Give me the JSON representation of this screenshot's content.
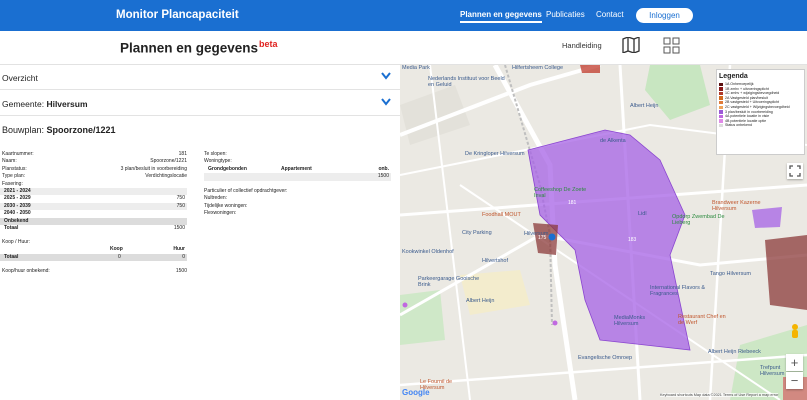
{
  "header": {
    "brand": "Monitor Plancapaciteit",
    "nav": [
      "Plannen en gegevens",
      "Publicaties",
      "Contact"
    ],
    "login": "Inloggen"
  },
  "subheader": {
    "title": "Plannen en gegevens",
    "beta": "beta",
    "handleiding": "Handleiding"
  },
  "accordion": {
    "overzicht": "Overzicht",
    "gemeente_label": "Gemeente:",
    "gemeente_value": "Hilversum"
  },
  "bouwplan": {
    "label": "Bouwplan:",
    "value": "Spoorzone/1221"
  },
  "details": [
    {
      "k": "Kaartnummer:",
      "v": "181"
    },
    {
      "k": "Naam:",
      "v": "Spoorzone/1221"
    },
    {
      "k": "Planstatus:",
      "v": "3 plan/besluit in voorbereiding"
    },
    {
      "k": "Type plan:",
      "v": "Verdichtingslocatie"
    },
    {
      "k": "Fasering:",
      "v": ""
    }
  ],
  "fasering": [
    {
      "k": "2021 - 2024",
      "v": ""
    },
    {
      "k": "2025 - 2029",
      "v": "750"
    },
    {
      "k": "2030 - 2039",
      "v": "750"
    },
    {
      "k": "2040 - 2050",
      "v": ""
    },
    {
      "k": "Onbekend",
      "v": ""
    },
    {
      "k": "Totaal",
      "v": "1500"
    }
  ],
  "koophuur": {
    "label": "Koop / Huur:",
    "koop": "Koop",
    "huur": "Huur",
    "totaal": "Totaal",
    "koop_val": "0",
    "huur_val": "0",
    "onbekend_label": "Koop/huur onbekend:",
    "onbekend_val": "1500"
  },
  "right_col": {
    "te_slopen": "Te slopen:",
    "woningtype": "Woningtype:",
    "grondgebonden": "Grondgebonden",
    "appartement": "Appartement",
    "onb": "onb.",
    "woningtype_val": "1500",
    "particulier": "Particulier of collectief opdrachtgever:",
    "nultreden": "Nultreden:",
    "tijdelijke": "Tijdelijke woningen:",
    "flexwoningen": "Flexwoningen:"
  },
  "legend": {
    "title": "Legenda",
    "items": [
      {
        "label": "1A Onherroepelijk",
        "color": "#5b1010"
      },
      {
        "label": "1B zmhv + uitvoeringsplicht",
        "color": "#8b1a1a"
      },
      {
        "label": "1C zmhv + wijzigingsbevoegdheid",
        "color": "#b23a2a"
      },
      {
        "label": "2A Vastgesteld plan/besluit",
        "color": "#d2691e"
      },
      {
        "label": "2B vastgesteld + Uitvoeringsplicht",
        "color": "#e07b39"
      },
      {
        "label": "2C vastgesteld + Wijzigingsbevoegdheid",
        "color": "#f0a35a"
      },
      {
        "label": "3 plan/besluit in voorbereiding",
        "color": "#9b59d6"
      },
      {
        "label": "4A potentiele locatie in visie",
        "color": "#c069e0"
      },
      {
        "label": "4B potentiele locatie optie",
        "color": "#e08ae8"
      },
      {
        "label": "Status onbekend",
        "color": "#dddddd"
      }
    ]
  },
  "map_labels": {
    "media_park": "Media Park",
    "beeld_geluid": "Nederlands Instituut voor Beeld en Geluid",
    "hilfertsheem": "Hilfertsheem College",
    "albert_heijn_1": "Albert Heijn",
    "kringloper": "De Kringloper Hilversum",
    "coffeeshop": "Coffeeshop De Zoete Inval",
    "de_alkenta": "de Alkenta",
    "foodhall": "Foodhall MOUT",
    "lidl": "Lidl",
    "opdorp": "Opdorp Zwembad De Lieberg",
    "brandweer": "Brandweer Kazerne Hilversum",
    "hilversum_st": "Hilversum",
    "city_parking": "City Parking",
    "kookwinkel": "Kookwinkel Oldenhof",
    "hilvertshof": "Hilvertshof",
    "parkeergarage": "Parkeergarage Gooische Brink",
    "albert_heijn_2": "Albert Heijn",
    "tango": "Tango Hilversum",
    "intl_flavors": "International Flavors & Fragrances",
    "mediamonks": "MediaMonks Hilversum",
    "restaurant": "Restaurant Chef en de Werf",
    "ah_riebeeck": "Albert Heijn Riebeeck",
    "evangelische": "Evangelische Omroep",
    "le_fournil": "Le Fournil de Hilversum",
    "trefpunt": "Trefpunt Hilversum"
  },
  "zones": {
    "z1": "181",
    "z2": "183",
    "z3": "175"
  },
  "attribution": "Keyboard shortcuts   Map data ©2021   Terms of Use   Report a map error",
  "google": "Google"
}
